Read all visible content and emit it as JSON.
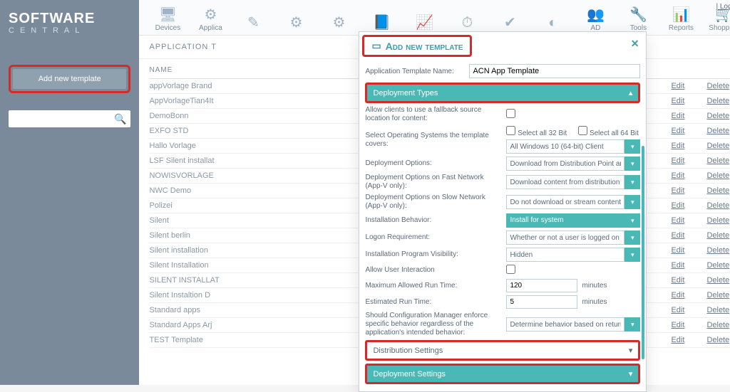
{
  "brand": {
    "main": "SOFTWARE",
    "sub": "CENTRAL"
  },
  "sidebar": {
    "add_btn": "Add new template",
    "search_placeholder": ""
  },
  "topnav": [
    {
      "label": "Devices",
      "icon": "🖥"
    },
    {
      "label": "Applica",
      "icon": "⚙"
    },
    {
      "label": "",
      "icon": "✎"
    },
    {
      "label": "",
      "icon": "⚙"
    },
    {
      "label": "",
      "icon": "⚙"
    },
    {
      "label": "",
      "icon": "📘"
    },
    {
      "label": "",
      "icon": "📈"
    },
    {
      "label": "",
      "icon": "⏱"
    },
    {
      "label": "",
      "icon": "✔"
    },
    {
      "label": "",
      "icon": "◐"
    },
    {
      "label": "AD",
      "icon": "👥"
    },
    {
      "label": "Tools",
      "icon": "🔧"
    },
    {
      "label": "Reports",
      "icon": "📊"
    },
    {
      "label": "Shopping",
      "icon": "🛒"
    }
  ],
  "logout": "Log Out",
  "crumb": "APPLICATION T",
  "table": {
    "head": "NAME",
    "edit": "Edit",
    "delete": "Delete",
    "rows": [
      "appVorlage Brand",
      "AppVorlageTian4It",
      "DemoBonn",
      "EXFO STD",
      "Hallo Vorlage",
      "LSF Silent installat",
      "NOWISVORLAGE",
      "NWC Demo",
      "Polizei",
      "Silent",
      "Silent berlin",
      "Silent installation",
      "Silent Installation",
      "SILENT INSTALLAT",
      "Silent Instaltion D",
      "Standard apps",
      "Standard Apps Arj",
      "TEST Template"
    ]
  },
  "modal": {
    "title": "Add new template",
    "name_label": "Application Template Name:",
    "name_value": "ACN App Template",
    "sections": {
      "deployment_types": "Deployment Types",
      "distribution": "Distribution Settings",
      "deployment_settings": "Deployment Settings"
    },
    "fields": {
      "fallback": "Allow clients to use a fallback source location for content:",
      "select_os": "Select Operating Systems the template covers:",
      "sel32": "Select all 32 Bit",
      "sel64": "Select all 64 Bit",
      "os_value": "All Windows 10 (64-bit) Client",
      "dep_opts": "Deployment Options:",
      "dep_opts_v": "Download from Distribution Point and run loc",
      "fast": "Deployment Options on Fast Network (App-V only):",
      "fast_v": "Download content from distribution point an",
      "slow": "Deployment Options on Slow Network (App-V only):",
      "slow_v": "Do not download or stream content",
      "install_beh": "Installation Behavior:",
      "install_beh_v": "Install for system",
      "logon": "Logon Requirement:",
      "logon_v": "Whether or not a user is logged on",
      "visibility": "Installation Program Visibility:",
      "visibility_v": "Hidden",
      "user_inter": "Allow User Interaction",
      "max_run": "Maximum Allowed Run Time:",
      "max_run_v": "120",
      "est_run": "Estimated Run Time:",
      "est_run_v": "5",
      "unit": "minutes",
      "enforce": "Should Configuration Manager enforce specific behavior regardless of the application's intended behavior:",
      "enforce_v": "Determine behavior based on return codes"
    }
  }
}
